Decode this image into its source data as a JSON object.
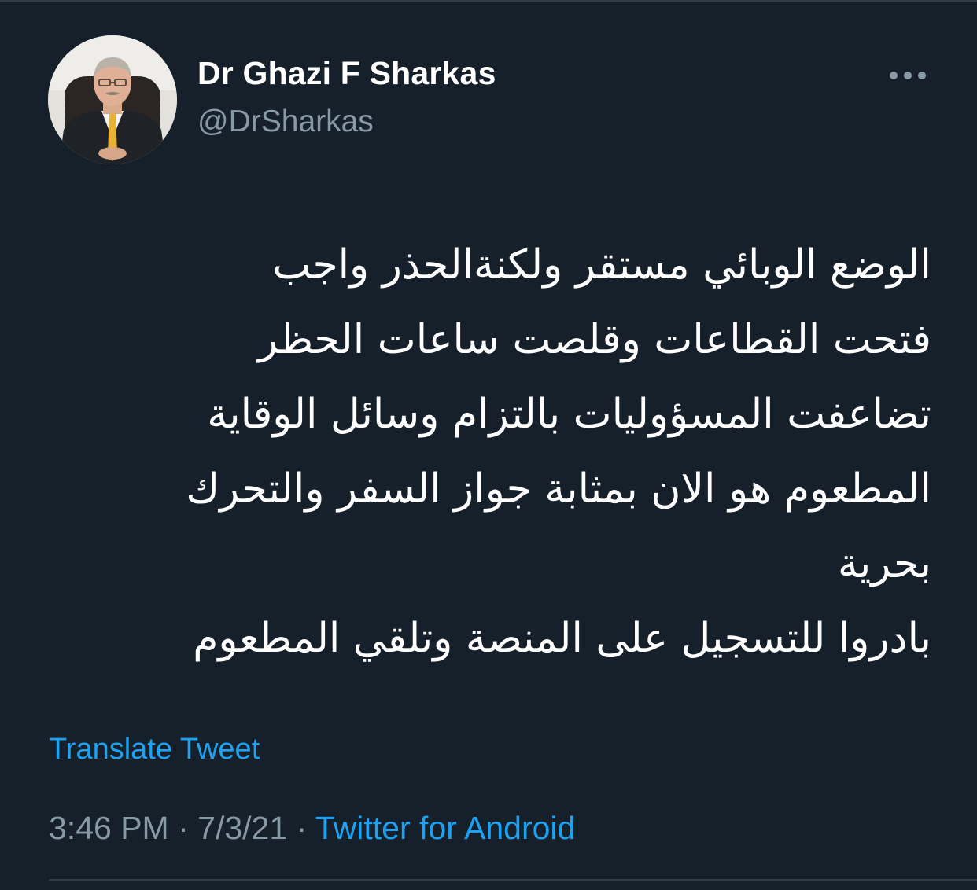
{
  "tweet": {
    "author": {
      "display_name": "Dr Ghazi F Sharkas",
      "handle": "@DrSharkas"
    },
    "text_lines": [
      "الوضع الوبائي مستقر ولكنةالحذر واجب",
      "فتحت القطاعات وقلصت ساعات الحظر",
      "تضاعفت المسؤوليات بالتزام وسائل الوقاية",
      "المطعوم هو الان بمثابة جواز السفر والتحرك",
      "بحرية",
      "بادروا للتسجيل على المنصة وتلقي المطعوم"
    ],
    "translate_label": "Translate Tweet",
    "time": "3:46 PM",
    "date": "7/3/21",
    "separator": "·",
    "source": "Twitter for Android"
  },
  "icons": {
    "more": "more-horizontal-icon",
    "avatar": "profile-photo"
  },
  "colors": {
    "background": "#15202b",
    "text_primary": "#ffffff",
    "text_secondary": "#8899a6",
    "accent": "#1da1f2",
    "divider": "#2f3b47"
  }
}
